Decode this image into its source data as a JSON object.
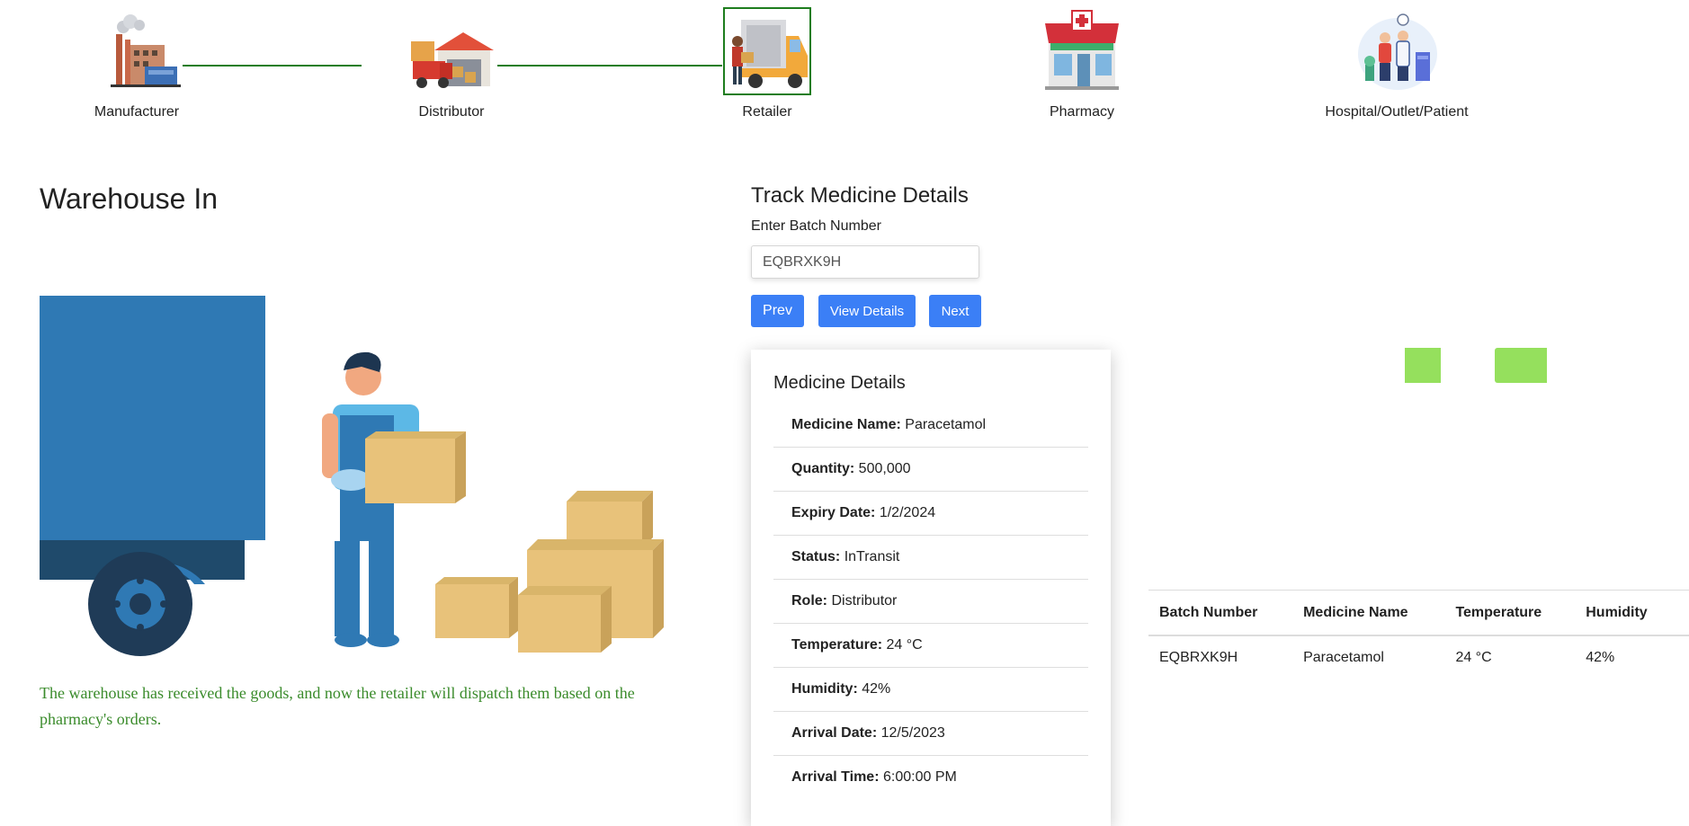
{
  "stages": [
    {
      "label": "Manufacturer",
      "icon": "factory-icon"
    },
    {
      "label": "Distributor",
      "icon": "warehouse-truck-icon"
    },
    {
      "label": "Retailer",
      "icon": "delivery-van-icon",
      "active": true
    },
    {
      "label": "Pharmacy",
      "icon": "pharmacy-store-icon"
    },
    {
      "label": "Hospital/Outlet/Patient",
      "icon": "doctor-patient-icon"
    }
  ],
  "colors": {
    "accent": "#3b7ff6",
    "stepper_line": "#1e7d1e",
    "caption_text": "#3a8b2b",
    "indicator": "#95e05d"
  },
  "warehouse": {
    "title": "Warehouse In",
    "caption": "The warehouse has received the goods, and now the retailer will dispatch them based on the pharmacy's orders."
  },
  "track": {
    "title": "Track Medicine Details",
    "batch_label": "Enter Batch Number",
    "batch_value": "EQBRXK9H",
    "buttons": {
      "prev": "Prev",
      "view": "View Details",
      "next": "Next"
    }
  },
  "details": {
    "title": "Medicine Details",
    "items": [
      {
        "label": "Medicine Name:",
        "value": "Paracetamol"
      },
      {
        "label": "Quantity:",
        "value": "500,000"
      },
      {
        "label": "Expiry Date:",
        "value": "1/2/2024"
      },
      {
        "label": "Status:",
        "value": "InTransit"
      },
      {
        "label": "Role:",
        "value": "Distributor"
      },
      {
        "label": "Temperature:",
        "value": "24 °C"
      },
      {
        "label": "Humidity:",
        "value": "42%"
      },
      {
        "label": "Arrival Date:",
        "value": "12/5/2023"
      },
      {
        "label": "Arrival Time:",
        "value": "6:00:00 PM"
      }
    ]
  },
  "table": {
    "headers": [
      "Batch Number",
      "Medicine Name",
      "Temperature",
      "Humidity"
    ],
    "rows": [
      [
        "EQBRXK9H",
        "Paracetamol",
        "24 °C",
        "42%"
      ]
    ]
  }
}
